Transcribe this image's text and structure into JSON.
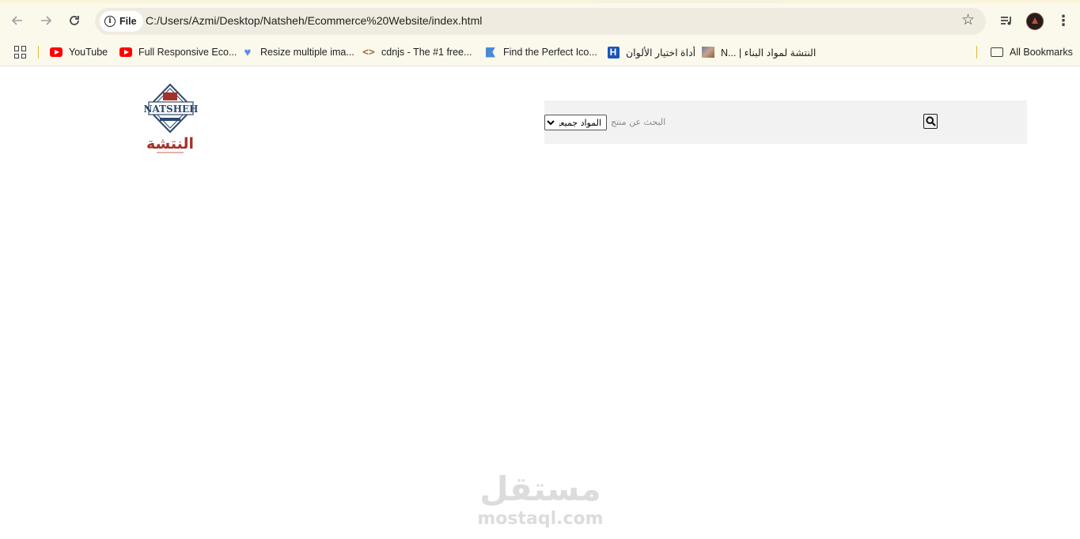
{
  "browser": {
    "site_chip_label": "File",
    "url": "C:/Users/Azmi/Desktop/Natsheh/Ecommerce%20Website/index.html",
    "icons": [
      "back-arrow-icon",
      "forward-arrow-icon",
      "reload-icon",
      "info-icon",
      "star-icon",
      "media-queue-icon",
      "avatar",
      "kebab-menu-icon"
    ]
  },
  "bookmarks": {
    "items": [
      {
        "label": "YouTube",
        "icon": "youtube-icon"
      },
      {
        "label": "Full Responsive Eco...",
        "icon": "youtube-icon"
      },
      {
        "label": "Resize multiple ima...",
        "icon": "heart-icon"
      },
      {
        "label": "cdnjs - The #1 free...",
        "icon": "code-icon"
      },
      {
        "label": "Find the Perfect Ico...",
        "icon": "flag-icon"
      },
      {
        "label": "أداة اختيار الألوان",
        "icon": "h-icon"
      },
      {
        "label": "N... | النتشة لمواد البناء",
        "icon": "thumbnail-icon"
      }
    ],
    "all_bookmarks_label": "All Bookmarks"
  },
  "page": {
    "logo": {
      "text_latin": "NATSHEH",
      "text_arabic": "النتشة"
    },
    "search": {
      "category_selected": "المواد جميعها",
      "placeholder": "البحث عن منتج"
    },
    "watermark": {
      "arabic": "مستقل",
      "latin": "mostaql.com"
    }
  },
  "colors": {
    "toolbar_bg": "#fbf8ec",
    "omnibox_bg": "#efebe0",
    "search_bar_bg": "#f2f2f2",
    "logo_red": "#a3332a",
    "logo_navy": "#2d4a6e",
    "watermark_gray": "#d9d9d9"
  }
}
